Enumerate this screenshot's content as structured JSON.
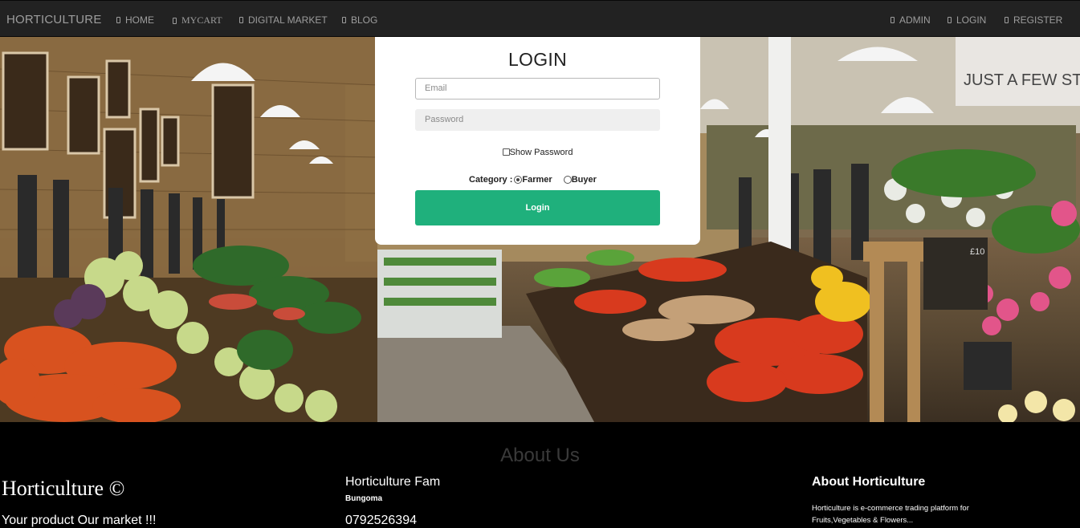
{
  "navbar": {
    "brand": "HORTICULTURE",
    "left_items": [
      {
        "label": "HOME",
        "icon": "home-icon"
      },
      {
        "label": "MYCART",
        "icon": "cart-icon"
      },
      {
        "label": "DIGITAL MARKET",
        "icon": "market-icon"
      },
      {
        "label": "BLOG",
        "icon": "blog-icon"
      }
    ],
    "right_items": [
      {
        "label": "ADMIN",
        "icon": "admin-icon"
      },
      {
        "label": "LOGIN",
        "icon": "login-icon"
      },
      {
        "label": "REGISTER",
        "icon": "register-icon"
      }
    ]
  },
  "hero": {
    "sign_text": "JUST A FEW STEP",
    "price_tag": "£10"
  },
  "login": {
    "title": "LOGIN",
    "email_placeholder": "Email",
    "password_placeholder": "Password",
    "show_password_label": "Show Password",
    "show_password_checked": false,
    "category_label": "Category :",
    "categories": [
      {
        "label": "Farmer",
        "checked": true
      },
      {
        "label": "Buyer",
        "checked": false
      }
    ],
    "submit_label": "Login",
    "button_color": "#1fb07c"
  },
  "footer": {
    "about_heading": "About Us",
    "brand": "Horticulture ©",
    "tagline": "Your product Our market !!!",
    "fam_name": "Horticulture Fam",
    "fam_location": "Bungoma",
    "fam_phone": "0792526394",
    "about_title": "About Horticulture",
    "about_text": "Horticulture is e-commerce trading platform for Fruits,Vegetables & Flowers..."
  }
}
